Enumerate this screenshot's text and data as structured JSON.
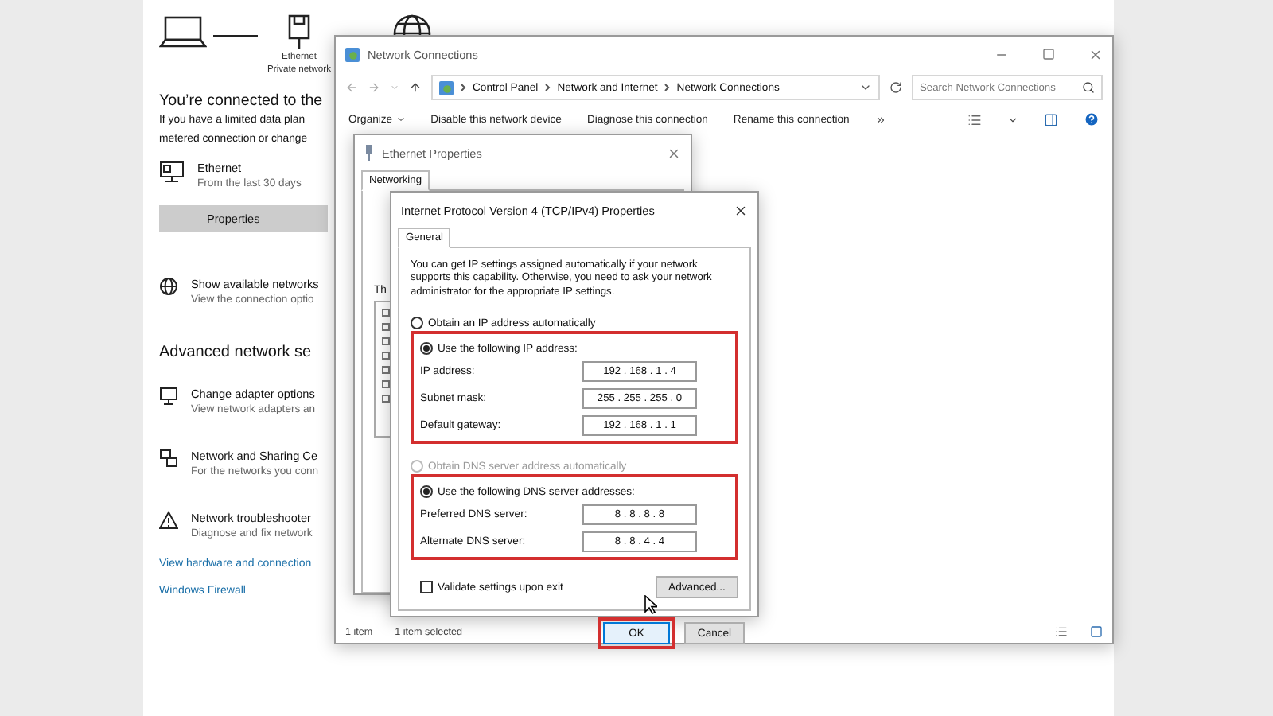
{
  "settings": {
    "diagram_labels": [
      "Ethernet",
      "Private network"
    ],
    "heading": "You’re connected to the",
    "description": [
      "If you have a limited data plan",
      "metered connection or change"
    ],
    "connection": {
      "name": "Ethernet",
      "detail": "From the last 30 days"
    },
    "properties_button": "Properties",
    "show_networks": {
      "title": "Show available networks",
      "subtitle": "View the connection optio"
    },
    "advanced_heading": "Advanced network se",
    "advanced_items": [
      {
        "kind": "adapter",
        "title": "Change adapter options",
        "subtitle": "View network adapters an"
      },
      {
        "kind": "sharing",
        "title": "Network and Sharing Ce",
        "subtitle": "For the networks you conn"
      },
      {
        "kind": "troubleshooter",
        "title": "Network troubleshooter",
        "subtitle": "Diagnose and fix network"
      }
    ],
    "links": [
      "View hardware and connection",
      "Windows Firewall"
    ]
  },
  "network_connections": {
    "title": "Network Connections",
    "breadcrumbs": [
      "Control Panel",
      "Network and Internet",
      "Network Connections"
    ],
    "search": {
      "placeholder": "Search Network Connections"
    },
    "toolbar": [
      "Organize",
      "Disable this network device",
      "Diagnose this connection",
      "Rename this connection"
    ],
    "status_bar": [
      "1 item",
      "1 item selected"
    ]
  },
  "ethernet_properties": {
    "title": "Ethernet Properties",
    "tabs": [
      {
        "label": "Networking",
        "selected": true
      }
    ],
    "partial_label": "Th"
  },
  "ipv4": {
    "title": "Internet Protocol Version 4 (TCP/IPv4) Properties",
    "tabs": [
      {
        "label": "General",
        "selected": true
      }
    ],
    "description": "You can get IP settings assigned automatically if your network supports this capability. Otherwise, you need to ask your network administrator for the appropriate IP settings.",
    "ip_options": [
      {
        "label": "Obtain an IP address automatically",
        "selected": false,
        "disabled": false
      },
      {
        "label": "Use the following IP address:",
        "selected": true,
        "disabled": false
      }
    ],
    "ip_highlighted": true,
    "ip_fields": [
      {
        "label": "IP address:",
        "value": "192 . 168 . 1 . 4"
      },
      {
        "label": "Subnet mask:",
        "value": "255 . 255 . 255 . 0"
      },
      {
        "label": "Default gateway:",
        "value": "192 . 168 . 1 . 1"
      }
    ],
    "dns_options": [
      {
        "label": "Obtain DNS server address automatically",
        "selected": false,
        "disabled": true
      },
      {
        "label": "Use the following DNS server addresses:",
        "selected": true,
        "disabled": false
      }
    ],
    "dns_highlighted": true,
    "dns_fields": [
      {
        "label": "Preferred DNS server:",
        "value": "8 . 8 . 8 . 8"
      },
      {
        "label": "Alternate DNS server:",
        "value": "8 . 8 . 4 . 4"
      }
    ],
    "validate": {
      "label": "Validate settings upon exit",
      "checked": false
    },
    "advanced_button": "Advanced...",
    "buttons": [
      {
        "label": "OK",
        "kind": "default",
        "highlighted": true
      },
      {
        "label": "Cancel",
        "kind": "normal",
        "highlighted": false
      }
    ]
  }
}
